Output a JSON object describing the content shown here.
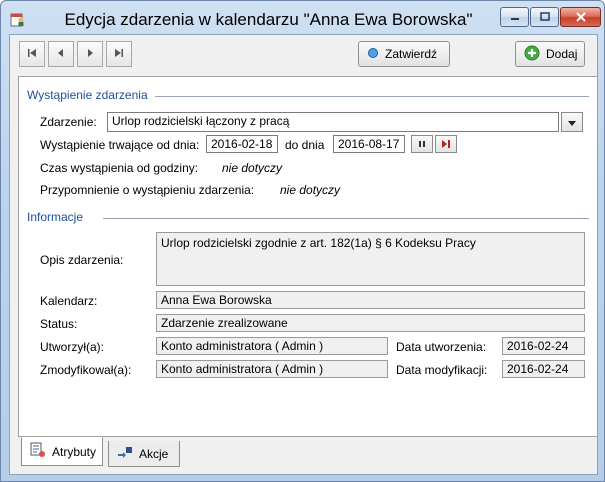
{
  "window": {
    "title": "Edycja zdarzenia w kalendarzu \"Anna Ewa Borowska\""
  },
  "toolbar": {
    "first_icon": "first-record-icon",
    "prev_icon": "previous-record-icon",
    "next_icon": "next-record-icon",
    "last_icon": "last-record-icon",
    "confirm_label": "Zatwierdź",
    "add_label": "Dodaj"
  },
  "occurrence": {
    "section_title": "Wystąpienie zdarzenia",
    "event_label": "Zdarzenie:",
    "event_value": "Urlop rodzicielski łączony z pracą",
    "range_label": "Wystąpienie trwające od dnia:",
    "date_from": "2016-02-18",
    "to_label": "do dnia",
    "date_to": "2016-08-17",
    "time_label": "Czas wystąpienia od godziny:",
    "time_value": "nie dotyczy",
    "reminder_label": "Przypomnienie o wystąpieniu zdarzenia:",
    "reminder_value": "nie dotyczy"
  },
  "info": {
    "section_title": "Informacje",
    "description_label": "Opis zdarzenia:",
    "description_value": "Urlop rodzicielski zgodnie z art. 182(1a) § 6 Kodeksu Pracy",
    "calendar_label": "Kalendarz:",
    "calendar_value": "Anna Ewa Borowska",
    "status_label": "Status:",
    "status_value": "Zdarzenie zrealizowane",
    "created_by_label": "Utworzył(a):",
    "created_by_value": "Konto administratora ( Admin )",
    "created_date_label": "Data utworzenia:",
    "created_date_value": "2016-02-24",
    "modified_by_label": "Zmodyfikował(a):",
    "modified_by_value": "Konto administratora ( Admin )",
    "modified_date_label": "Data modyfikacji:",
    "modified_date_value": "2016-02-24"
  },
  "tabs": [
    {
      "label": "Atrybuty",
      "active": true
    },
    {
      "label": "Akcje",
      "active": false
    }
  ],
  "colors": {
    "section_title": "#1f4f9c",
    "confirm_icon": "#2a7fd4",
    "add_icon": "#3aa63a",
    "close_button": "#c8402a"
  }
}
